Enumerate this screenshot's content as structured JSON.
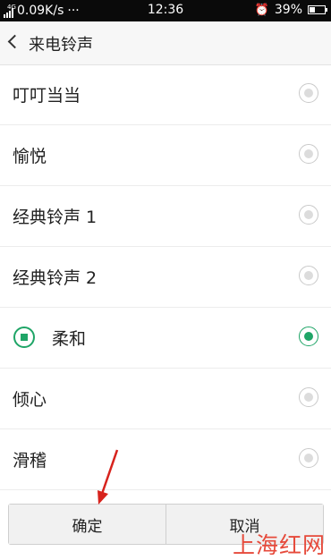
{
  "status_bar": {
    "net_type": "4G",
    "speed": "0.09K/s",
    "more": "···",
    "time": "12:36",
    "battery_percent": "39%",
    "battery_level": 0.39
  },
  "header": {
    "title": "来电铃声"
  },
  "ringtones": [
    {
      "name": "叮叮当当",
      "selected": false
    },
    {
      "name": "愉悦",
      "selected": false
    },
    {
      "name": "经典铃声 1",
      "selected": false
    },
    {
      "name": "经典铃声 2",
      "selected": false
    },
    {
      "name": "柔和",
      "selected": true
    },
    {
      "name": "倾心",
      "selected": false
    },
    {
      "name": "滑稽",
      "selected": false
    }
  ],
  "footer": {
    "confirm_label": "确定",
    "cancel_label": "取消"
  },
  "watermark": "上海红网",
  "colors": {
    "accent": "#1fa567",
    "arrow": "#d7231d",
    "watermark": "#e64a3b"
  }
}
